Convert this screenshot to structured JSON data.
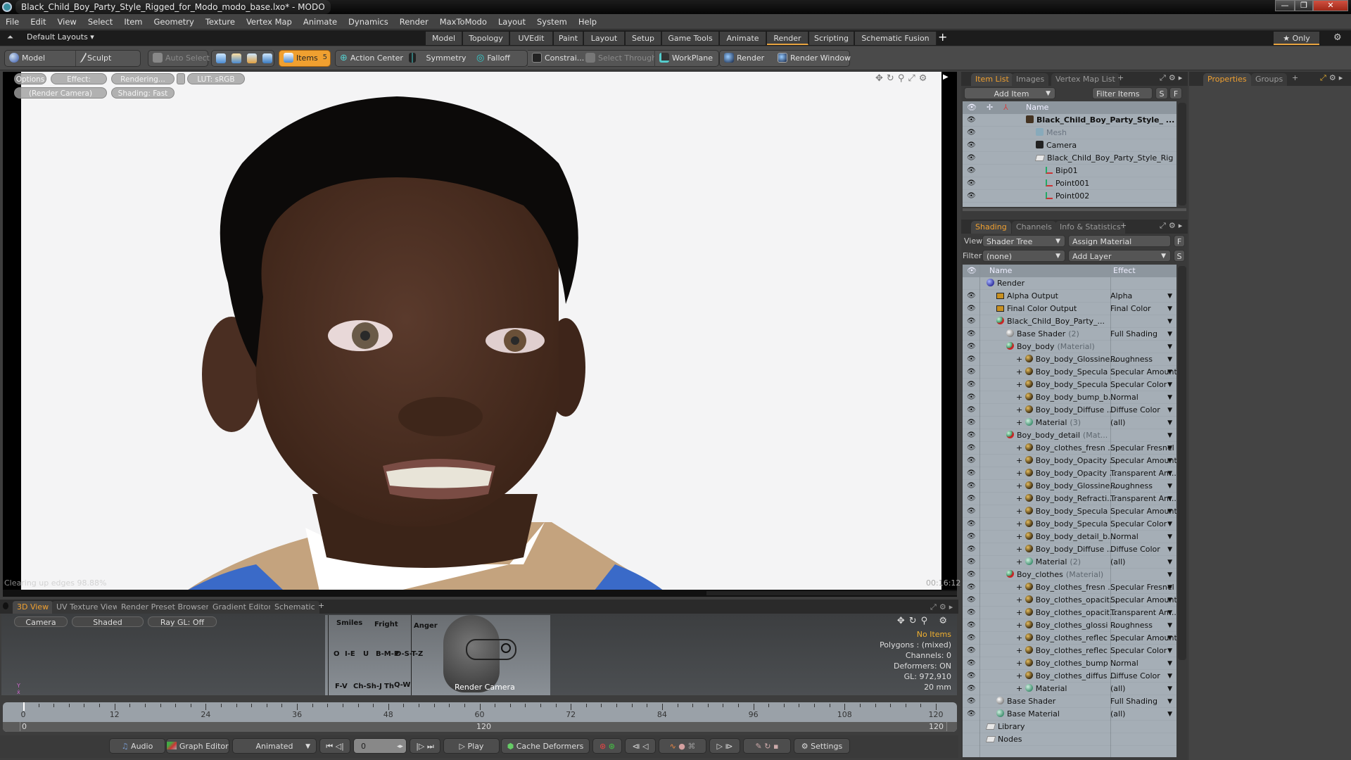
{
  "window": {
    "title": "Black_Child_Boy_Party_Style_Rigged_for_Modo_modo_base.lxo* - MODO",
    "controls": {
      "minimize": "—",
      "maximize": "❐",
      "close": "✕"
    }
  },
  "menu": [
    "File",
    "Edit",
    "View",
    "Select",
    "Item",
    "Geometry",
    "Texture",
    "Vertex Map",
    "Animate",
    "Dynamics",
    "Render",
    "MaxToModo",
    "Layout",
    "System",
    "Help"
  ],
  "layouts": {
    "default_label": "Default Layouts ▾",
    "tabs": [
      "Model",
      "Topology",
      "UVEdit",
      "Paint",
      "Layout",
      "Setup",
      "Game Tools",
      "Animate",
      "Render",
      "Scripting",
      "Schematic Fusion"
    ],
    "active_tab": "Render",
    "add": "+",
    "only_label": "★ Only"
  },
  "toolbar": {
    "model": "Model",
    "sculpt": "Sculpt",
    "auto_select": "Auto Select",
    "items": "Items",
    "items_badge": "5",
    "action_center": "Action Center",
    "symmetry": "Symmetry",
    "falloff": "Falloff",
    "constraints": "Constrai...",
    "select_through": "Select Through",
    "workplane": "WorkPlane",
    "render": "Render",
    "render_window": "Render Window"
  },
  "viewport": {
    "chips_row1": [
      "Options",
      "Effect: (Shadi...",
      "Rendering...",
      "LUT: sRGB"
    ],
    "chips_row2": [
      "(Render Camera)",
      "Shading: Fast"
    ],
    "status": "Clearing up edges 98.88%",
    "time": "00:16:12"
  },
  "bottom_tabs": {
    "tabs": [
      "3D View",
      "UV Texture View",
      "Render Preset Browser",
      "Gradient Editor",
      "Schematic"
    ],
    "active": "3D View",
    "add": "+"
  },
  "view3d": {
    "chips": [
      "Camera",
      "Shaded",
      "Ray GL: Off"
    ],
    "info": {
      "selection": "No Items",
      "polygons": "Polygons : (mixed)",
      "channels": "Channels: 0",
      "deformers": "Deformers: ON",
      "gl": "GL: 972,910",
      "size": "20 mm"
    },
    "scene_labels": [
      "Smiles",
      "Fright",
      "Anger",
      "O",
      "I-E",
      "U",
      "B-M-P",
      "D-S-T-Z",
      "F-V",
      "Ch-Sh-J",
      "Th",
      "Q-W"
    ],
    "camera_label": "Render Camera"
  },
  "timeline": {
    "ticks": [
      0,
      12,
      24,
      36,
      48,
      60,
      72,
      84,
      96,
      108,
      120
    ],
    "range_start": "0",
    "range_mid": "120",
    "range_end": "120",
    "current_frame": 0
  },
  "transport": {
    "audio": "Audio",
    "graph_editor": "Graph Editor",
    "mode": "Animated",
    "frame_value": "0",
    "play": "Play",
    "cache_deformers": "Cache Deformers",
    "settings": "Settings"
  },
  "item_list": {
    "tabs": [
      "Item List",
      "Images",
      "Vertex Map List"
    ],
    "active": "Item List",
    "add_item": "Add Item",
    "filter_placeholder": "Filter Items",
    "s_btn": "S",
    "f_btn": "F",
    "header_name": "Name",
    "rows": [
      {
        "label": "Black_Child_Boy_Party_Style_ ...",
        "icon": "scene",
        "bold": true,
        "indent": 0
      },
      {
        "label": "Mesh",
        "icon": "mesh",
        "dim": true,
        "indent": 1
      },
      {
        "label": "Camera",
        "icon": "camera",
        "indent": 1
      },
      {
        "label": "Black_Child_Boy_Party_Style_Rig ...",
        "icon": "folder",
        "indent": 1
      },
      {
        "label": "Bip01",
        "icon": "locator",
        "indent": 2
      },
      {
        "label": "Point001",
        "icon": "locator",
        "indent": 2
      },
      {
        "label": "Point002",
        "icon": "locator",
        "indent": 2
      }
    ]
  },
  "properties": {
    "tabs": [
      "Properties",
      "Groups"
    ],
    "active": "Properties"
  },
  "shading": {
    "tabs": [
      "Shading",
      "Channels",
      "Info & Statistics"
    ],
    "active": "Shading",
    "view_label": "View",
    "view_value": "Shader Tree",
    "assign_material": "Assign Material",
    "filter_label": "Filter",
    "filter_value": "(none)",
    "add_layer": "Add Layer",
    "f_btn": "F",
    "s_btn": "S",
    "header_name": "Name",
    "header_effect": "Effect",
    "rows": [
      {
        "name": "Render",
        "icon": "blue",
        "effect": "",
        "indent": 0,
        "eye": false
      },
      {
        "name": "Alpha Output",
        "icon": "image",
        "effect": "Alpha",
        "indent": 1
      },
      {
        "name": "Final Color Output",
        "icon": "image",
        "effect": "Final Color",
        "indent": 1
      },
      {
        "name": "Black_Child_Boy_Party_...",
        "icon": "mat",
        "effect": "",
        "indent": 1
      },
      {
        "name": "Base Shader",
        "suffix": "(2)",
        "icon": "white",
        "effect": "Full Shading",
        "indent": 2
      },
      {
        "name": "Boy_body",
        "suffix": "(Material)",
        "icon": "mat",
        "effect": "",
        "indent": 2
      },
      {
        "name": "Boy_body_Glossine...",
        "icon": "gold",
        "effect": "Roughness",
        "indent": 3
      },
      {
        "name": "Boy_body_Specula ...",
        "icon": "gold",
        "effect": "Specular Amount",
        "indent": 3
      },
      {
        "name": "Boy_body_Specula ...",
        "icon": "gold",
        "effect": "Specular Color",
        "indent": 3
      },
      {
        "name": "Boy_body_bump_b...",
        "icon": "gold",
        "effect": "Normal",
        "indent": 3
      },
      {
        "name": "Boy_body_Diffuse ...",
        "icon": "gold",
        "effect": "Diffuse Color",
        "indent": 3
      },
      {
        "name": "Material",
        "suffix": "(3)",
        "icon": "green",
        "effect": "(all)",
        "indent": 3
      },
      {
        "name": "Boy_body_detail",
        "suffix": "(Mat...",
        "icon": "mat",
        "effect": "",
        "indent": 2
      },
      {
        "name": "Boy_clothes_fresn ...",
        "icon": "gold",
        "effect": "Specular Fresnel",
        "indent": 3
      },
      {
        "name": "Boy_body_Opacity ...",
        "icon": "gold",
        "effect": "Specular Amount",
        "indent": 3
      },
      {
        "name": "Boy_body_Opacity ...",
        "icon": "gold",
        "effect": "Transparent Am...",
        "indent": 3
      },
      {
        "name": "Boy_body_Glossine...",
        "icon": "gold",
        "effect": "Roughness",
        "indent": 3
      },
      {
        "name": "Boy_body_Refracti...",
        "icon": "gold",
        "effect": "Transparent Am...",
        "indent": 3
      },
      {
        "name": "Boy_body_Specula ...",
        "icon": "gold",
        "effect": "Specular Amount",
        "indent": 3
      },
      {
        "name": "Boy_body_Specula ...",
        "icon": "gold",
        "effect": "Specular Color",
        "indent": 3
      },
      {
        "name": "Boy_body_detail_b...",
        "icon": "gold",
        "effect": "Normal",
        "indent": 3
      },
      {
        "name": "Boy_body_Diffuse ...",
        "icon": "gold",
        "effect": "Diffuse Color",
        "indent": 3
      },
      {
        "name": "Material",
        "suffix": "(2)",
        "icon": "green",
        "effect": "(all)",
        "indent": 3
      },
      {
        "name": "Boy_clothes",
        "suffix": "(Material)",
        "icon": "mat",
        "effect": "",
        "indent": 2
      },
      {
        "name": "Boy_clothes_fresn ...",
        "icon": "gold",
        "effect": "Specular Fresnel",
        "indent": 3
      },
      {
        "name": "Boy_clothes_opacit...",
        "icon": "gold",
        "effect": "Specular Amount",
        "indent": 3
      },
      {
        "name": "Boy_clothes_opacit...",
        "icon": "gold",
        "effect": "Transparent Am...",
        "indent": 3
      },
      {
        "name": "Boy_clothes_glossi ...",
        "icon": "gold",
        "effect": "Roughness",
        "indent": 3
      },
      {
        "name": "Boy_clothes_reflec ...",
        "icon": "gold",
        "effect": "Specular Amount",
        "indent": 3
      },
      {
        "name": "Boy_clothes_reflec ...",
        "icon": "gold",
        "effect": "Specular Color",
        "indent": 3
      },
      {
        "name": "Boy_clothes_bump ...",
        "icon": "gold",
        "effect": "Normal",
        "indent": 3
      },
      {
        "name": "Boy_clothes_diffus ...",
        "icon": "gold",
        "effect": "Diffuse Color",
        "indent": 3
      },
      {
        "name": "Material",
        "icon": "green",
        "effect": "(all)",
        "indent": 3
      },
      {
        "name": "Base Shader",
        "icon": "white",
        "effect": "Full Shading",
        "indent": 1
      },
      {
        "name": "Base Material",
        "icon": "green",
        "effect": "(all)",
        "indent": 1
      },
      {
        "name": "Library",
        "icon": "folder",
        "effect": "",
        "indent": 0,
        "eye": false,
        "nodrop": true
      },
      {
        "name": "Nodes",
        "icon": "folder",
        "effect": "",
        "indent": 0,
        "eye": false,
        "nodrop": true
      }
    ]
  },
  "colors": {
    "accent": "#f0a030",
    "tree_bg": "#a5aeb6",
    "viewport_bg": "#f4f4f5"
  }
}
